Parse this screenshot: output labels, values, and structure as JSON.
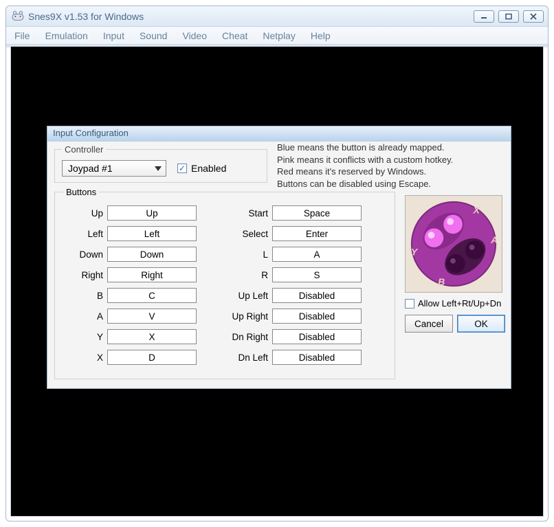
{
  "window": {
    "title": "Snes9X v1.53 for Windows"
  },
  "menubar": [
    "File",
    "Emulation",
    "Input",
    "Sound",
    "Video",
    "Cheat",
    "Netplay",
    "Help"
  ],
  "dialog": {
    "title": "Input Configuration",
    "controller": {
      "legend": "Controller",
      "selected": "Joypad #1",
      "enabled_label": "Enabled",
      "enabled": true
    },
    "info": {
      "line1": "Blue means the button is already mapped.",
      "line2": "Pink means it conflicts with a custom hotkey.",
      "line3": "Red means it's reserved by Windows.",
      "line4": "Buttons can be disabled using Escape."
    },
    "buttons_legend": "Buttons",
    "left_col": [
      {
        "label": "Up",
        "value": "Up"
      },
      {
        "label": "Left",
        "value": "Left"
      },
      {
        "label": "Down",
        "value": "Down"
      },
      {
        "label": "Right",
        "value": "Right"
      },
      {
        "label": "B",
        "value": "C"
      },
      {
        "label": "A",
        "value": "V"
      },
      {
        "label": "Y",
        "value": "X"
      },
      {
        "label": "X",
        "value": "D"
      }
    ],
    "right_col": [
      {
        "label": "Start",
        "value": "Space"
      },
      {
        "label": "Select",
        "value": "Enter"
      },
      {
        "label": "L",
        "value": "A"
      },
      {
        "label": "R",
        "value": "S"
      },
      {
        "label": "Up Left",
        "value": "Disabled"
      },
      {
        "label": "Up Right",
        "value": "Disabled"
      },
      {
        "label": "Dn Right",
        "value": "Disabled"
      },
      {
        "label": "Dn Left",
        "value": "Disabled"
      }
    ],
    "pad_labels": {
      "x": "X",
      "a": "A",
      "b": "B",
      "y": "Y"
    },
    "allow_label": "Allow Left+Rt/Up+Dn",
    "allow_checked": false,
    "cancel_label": "Cancel",
    "ok_label": "OK"
  }
}
